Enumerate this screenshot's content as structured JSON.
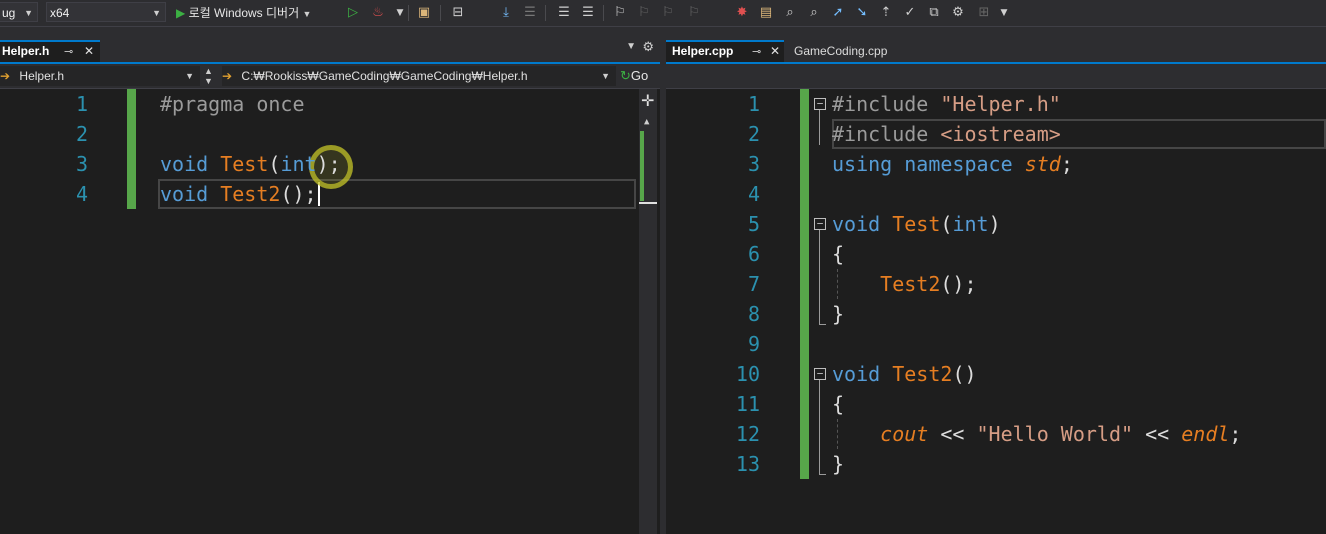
{
  "toolbar": {
    "config": "ug",
    "platform": "x64",
    "run_label": "로컬 Windows 디버거",
    "icons": [
      "start-icon",
      "start-without-debug-icon",
      "hot-reload-icon",
      "solution-explorer-icon",
      "layout-icon",
      "step-icon",
      "bookmark-icon",
      "misc-icons"
    ]
  },
  "left_pane": {
    "tabs": [
      {
        "label": "Helper.h",
        "active": true
      }
    ],
    "nav": {
      "file": "Helper.h",
      "path": "C:₩Rookiss₩GameCoding₩GameCoding₩Helper.h",
      "go_label": "Go"
    },
    "lines": [
      {
        "num": "1",
        "segments": [
          {
            "t": "#pragma once",
            "c": "pp"
          }
        ]
      },
      {
        "num": "2",
        "segments": []
      },
      {
        "num": "3",
        "segments": [
          {
            "t": "void",
            "c": "kw"
          },
          {
            "t": " ",
            "c": "pun"
          },
          {
            "t": "Test",
            "c": "fn"
          },
          {
            "t": "(",
            "c": "pun"
          },
          {
            "t": "int",
            "c": "kw"
          },
          {
            "t": ");",
            "c": "pun"
          }
        ]
      },
      {
        "num": "4",
        "segments": [
          {
            "t": "void",
            "c": "kw"
          },
          {
            "t": " ",
            "c": "pun"
          },
          {
            "t": "Test2",
            "c": "fn"
          },
          {
            "t": "();",
            "c": "pun"
          }
        ]
      }
    ]
  },
  "right_pane": {
    "tabs": [
      {
        "label": "Helper.cpp",
        "active": true
      },
      {
        "label": "GameCoding.cpp",
        "active": false
      }
    ],
    "lines": [
      {
        "num": "1",
        "segments": [
          {
            "t": "#include ",
            "c": "pp"
          },
          {
            "t": "\"Helper.h\"",
            "c": "str"
          }
        ]
      },
      {
        "num": "2",
        "segments": [
          {
            "t": "#include ",
            "c": "pp"
          },
          {
            "t": "<iostream>",
            "c": "str"
          }
        ]
      },
      {
        "num": "3",
        "segments": [
          {
            "t": "using",
            "c": "kw"
          },
          {
            "t": " ",
            "c": "pun"
          },
          {
            "t": "namespace",
            "c": "kw"
          },
          {
            "t": " ",
            "c": "pun"
          },
          {
            "t": "std",
            "c": "ital"
          },
          {
            "t": ";",
            "c": "pun"
          }
        ]
      },
      {
        "num": "4",
        "segments": []
      },
      {
        "num": "5",
        "segments": [
          {
            "t": "void",
            "c": "kw"
          },
          {
            "t": " ",
            "c": "pun"
          },
          {
            "t": "Test",
            "c": "fn"
          },
          {
            "t": "(",
            "c": "pun"
          },
          {
            "t": "int",
            "c": "kw"
          },
          {
            "t": ")",
            "c": "pun"
          }
        ]
      },
      {
        "num": "6",
        "segments": [
          {
            "t": "{",
            "c": "pun"
          }
        ]
      },
      {
        "num": "7",
        "segments": [
          {
            "t": "    ",
            "c": "pun"
          },
          {
            "t": "Test2",
            "c": "fn"
          },
          {
            "t": "();",
            "c": "pun"
          }
        ]
      },
      {
        "num": "8",
        "segments": [
          {
            "t": "}",
            "c": "pun"
          }
        ]
      },
      {
        "num": "9",
        "segments": []
      },
      {
        "num": "10",
        "segments": [
          {
            "t": "void",
            "c": "kw"
          },
          {
            "t": " ",
            "c": "pun"
          },
          {
            "t": "Test2",
            "c": "fn"
          },
          {
            "t": "()",
            "c": "pun"
          }
        ]
      },
      {
        "num": "11",
        "segments": [
          {
            "t": "{",
            "c": "pun"
          }
        ]
      },
      {
        "num": "12",
        "segments": [
          {
            "t": "    ",
            "c": "pun"
          },
          {
            "t": "cout",
            "c": "ital"
          },
          {
            "t": " << ",
            "c": "pun"
          },
          {
            "t": "\"Hello World\"",
            "c": "str"
          },
          {
            "t": " << ",
            "c": "pun"
          },
          {
            "t": "endl",
            "c": "ital"
          },
          {
            "t": ";",
            "c": "pun"
          }
        ]
      },
      {
        "num": "13",
        "segments": [
          {
            "t": "}",
            "c": "pun"
          }
        ]
      }
    ]
  },
  "colors": {
    "accent": "#007acc",
    "change_bar": "#57a64a",
    "line_number": "#2b91af",
    "keyword": "#569cd6",
    "function": "#e67e22"
  }
}
